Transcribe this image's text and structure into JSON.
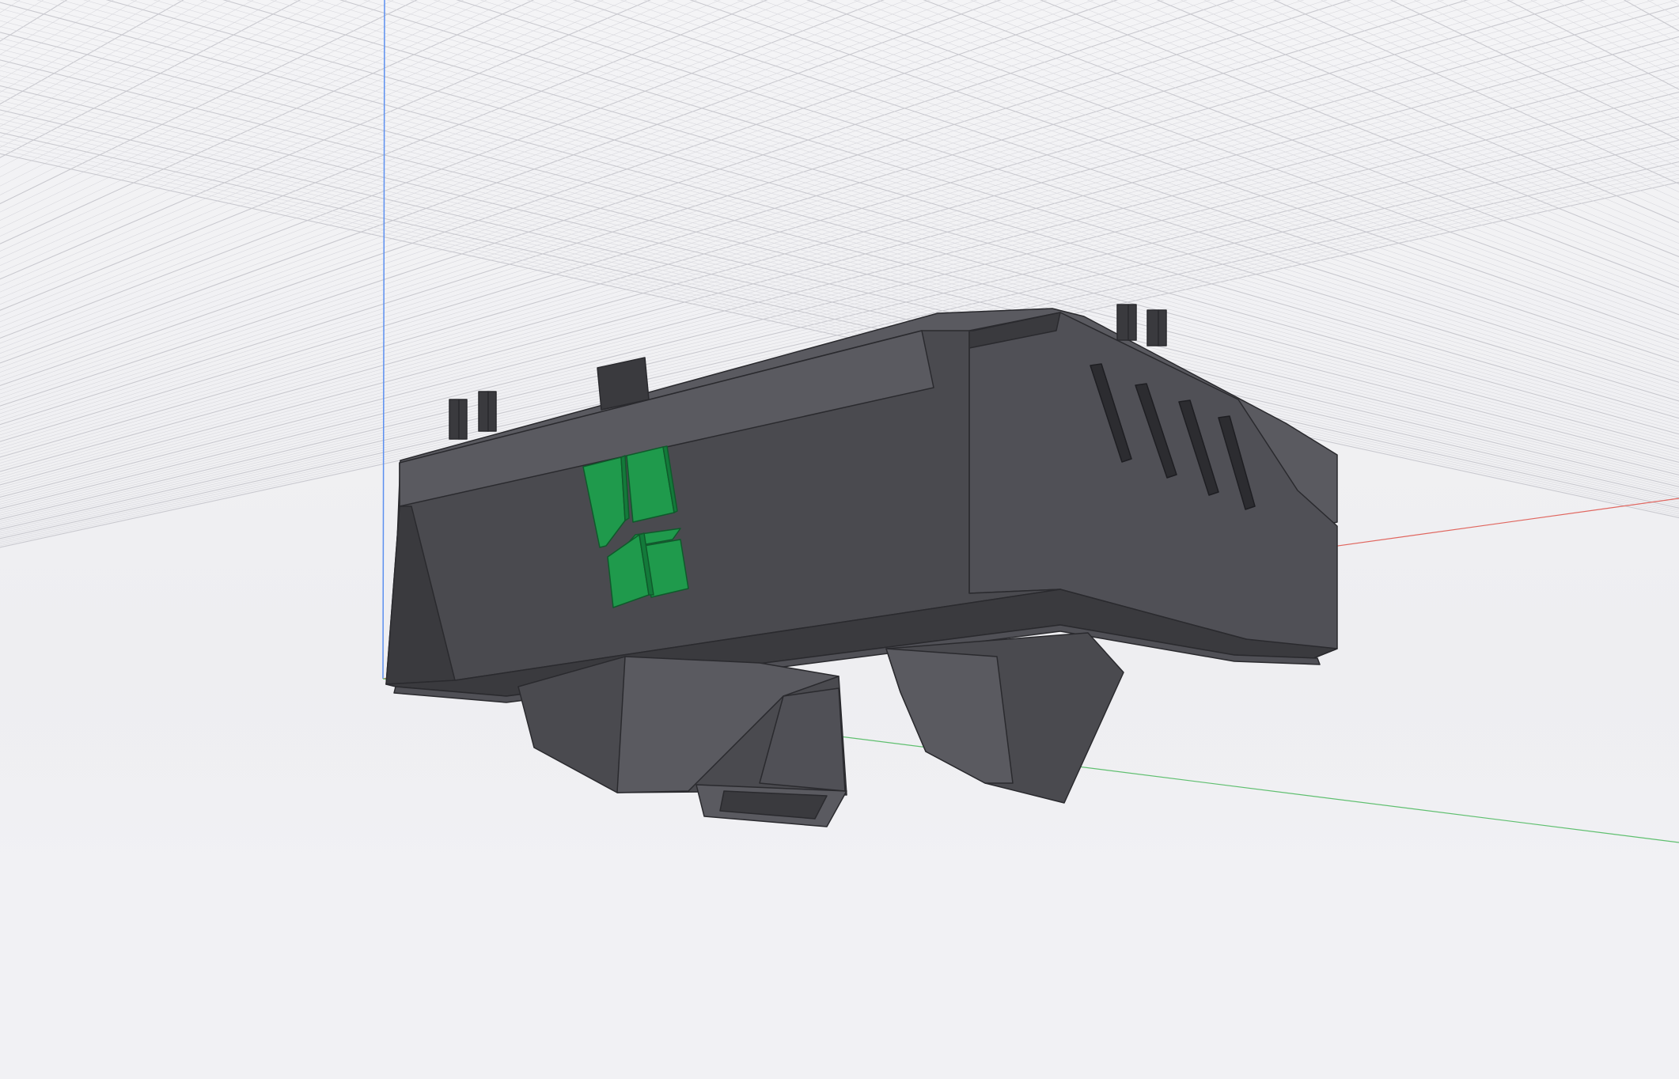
{
  "viewport": {
    "background_color": "#f3f3f5",
    "grid_color": "#d9d9de",
    "grid_major_color": "#c9c9cf"
  },
  "axes": {
    "x_axis_color": "#e0665f",
    "y_axis_color": "#5fbf6f",
    "z_axis_color": "#5b8ff0"
  },
  "model": {
    "body_color": "#4a4a4f",
    "body_dark_color": "#3a3a3e",
    "body_light_color": "#5a5a60",
    "logo_color": "#1f9a4c",
    "logo_icon": "green-logo-mark-icon",
    "vent_icon": "vent-slot-icon",
    "clip_icon": "retaining-clip-icon"
  }
}
